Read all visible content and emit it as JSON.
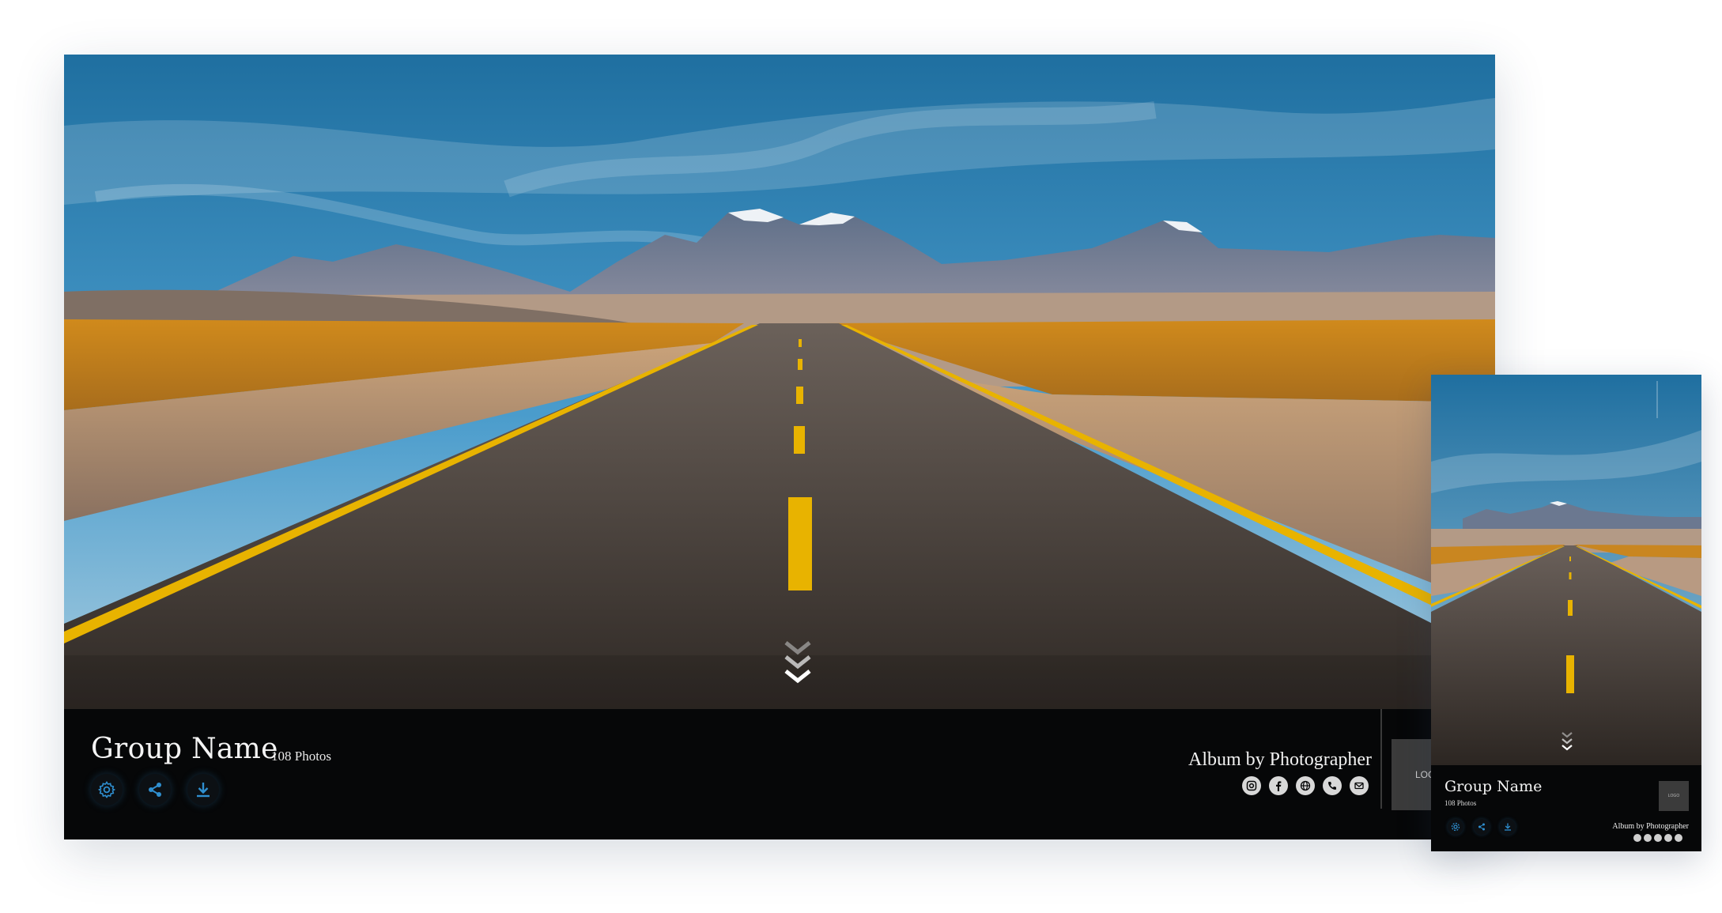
{
  "gallery": {
    "group_name": "Group Name",
    "photo_count": "108 Photos",
    "album_credit": "Album by Photographer",
    "logo_text": "LOGO",
    "action_icons": [
      "settings-icon",
      "share-icon",
      "download-icon"
    ],
    "social_icons": [
      "instagram-icon",
      "facebook-icon",
      "website-icon",
      "phone-icon",
      "email-icon"
    ],
    "scroll_icon": "chevrons-down-icon"
  },
  "mobile_preview": {
    "group_name": "Group Name",
    "photo_count": "108 Photos",
    "album_credit": "Album by Photographer",
    "logo_text": "LOGO"
  },
  "colors": {
    "bar_background": "#060708",
    "accent_icon": "#2f8fd0",
    "road_line": "#e8b300"
  }
}
